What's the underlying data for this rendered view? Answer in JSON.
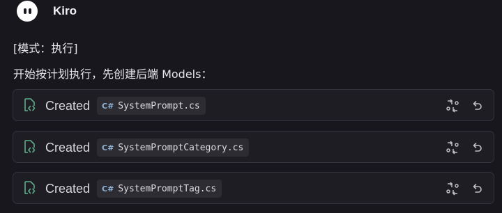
{
  "app": {
    "name": "Kiro"
  },
  "message": {
    "mode": "[模式：执行]",
    "plan": "开始按计划执行，先创建后端 Models："
  },
  "files": [
    {
      "status": "Created",
      "name": "SystemPrompt.cs",
      "lang_icon": "C#"
    },
    {
      "status": "Created",
      "name": "SystemPromptCategory.cs",
      "lang_icon": "C#"
    },
    {
      "status": "Created",
      "name": "SystemPromptTag.cs",
      "lang_icon": "C#"
    }
  ],
  "icons": {
    "file": "file-code-icon",
    "compare": "compare-changes-icon",
    "undo": "undo-icon"
  },
  "colors": {
    "background": "#18171d",
    "card": "#1e1d23",
    "accent_green": "#5fae8a",
    "csharp_blue": "#8fb3d6"
  }
}
